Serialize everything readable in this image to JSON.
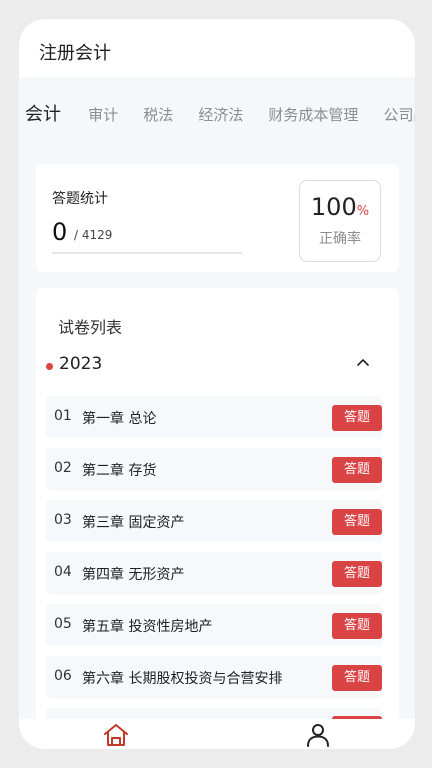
{
  "header": {
    "title": "注册会计"
  },
  "tabs": [
    {
      "label": "会计"
    },
    {
      "label": "审计"
    },
    {
      "label": "税法"
    },
    {
      "label": "经济法"
    },
    {
      "label": "财务成本管理"
    },
    {
      "label": "公司战"
    }
  ],
  "stats": {
    "label": "答题统计",
    "answered": "0",
    "total": "/ 4129",
    "rate_value": "100",
    "rate_unit": "%",
    "rate_label": "正确率"
  },
  "paper_list": {
    "title": "试卷列表",
    "year": "2023",
    "button_label": "答题",
    "items": [
      {
        "num": "01",
        "name": "第一章 总论"
      },
      {
        "num": "02",
        "name": "第二章 存货"
      },
      {
        "num": "03",
        "name": "第三章 固定资产"
      },
      {
        "num": "04",
        "name": "第四章 无形资产"
      },
      {
        "num": "05",
        "name": "第五章 投资性房地产"
      },
      {
        "num": "06",
        "name": "第六章 长期股权投资与合营安排"
      }
    ]
  },
  "nav": {
    "home": "首页",
    "mine": "我的"
  },
  "colors": {
    "accent": "#d94343",
    "text_primary": "#222222",
    "text_muted": "#8d8d8d",
    "background": "#f6f7fb"
  }
}
